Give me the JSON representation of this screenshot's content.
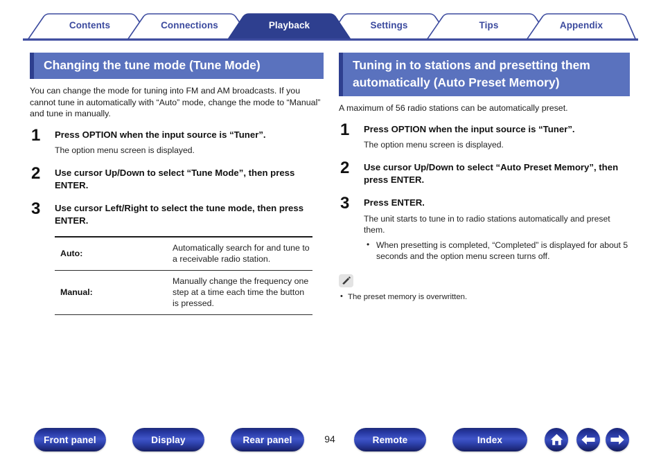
{
  "tabs": [
    {
      "label": "Contents",
      "active": false
    },
    {
      "label": "Connections",
      "active": false
    },
    {
      "label": "Playback",
      "active": true
    },
    {
      "label": "Settings",
      "active": false
    },
    {
      "label": "Tips",
      "active": false
    },
    {
      "label": "Appendix",
      "active": false
    }
  ],
  "colors": {
    "tab_outline": "#3b4a9e",
    "tab_active_bg": "#2e3f8f",
    "section_head_bg": "#5a72be",
    "section_head_accent": "#2e3f8f",
    "pill_blue": "#2637a0"
  },
  "left": {
    "heading": "Changing the tune mode (Tune Mode)",
    "intro": "You can change the mode for tuning into FM and AM broadcasts. If you cannot tune in automatically with “Auto” mode, change the mode to “Manual” and tune in manually.",
    "steps": [
      {
        "num": "1",
        "title": "Press OPTION when the input source is “Tuner”.",
        "desc": "The option menu screen is displayed."
      },
      {
        "num": "2",
        "title": "Use cursor Up/Down to select “Tune Mode”, then press ENTER.",
        "desc": ""
      },
      {
        "num": "3",
        "title": "Use cursor Left/Right to select the tune mode, then press ENTER.",
        "desc": ""
      }
    ],
    "table": {
      "rows": [
        {
          "key": "Auto:",
          "value": "Automatically search for and tune to a receivable radio station."
        },
        {
          "key": "Manual:",
          "value": "Manually change the frequency one step at a time each time the button is pressed."
        }
      ]
    }
  },
  "right": {
    "heading": "Tuning in to stations and presetting them automatically (Auto Preset Memory)",
    "intro": "A maximum of 56 radio stations can be automatically preset.",
    "steps": [
      {
        "num": "1",
        "title": "Press OPTION when the input source is “Tuner”.",
        "desc": "The option menu screen is displayed."
      },
      {
        "num": "2",
        "title": "Use cursor Up/Down to select “Auto Preset Memory”, then press ENTER.",
        "desc": ""
      },
      {
        "num": "3",
        "title": "Press ENTER.",
        "desc": "The unit starts to tune in to radio stations automatically and preset them.",
        "bullets": [
          "When presetting is completed, “Completed” is displayed for about 5 seconds and the option menu screen turns off."
        ]
      }
    ],
    "note": {
      "icon": "pencil-icon",
      "items": [
        "The preset memory is overwritten."
      ]
    }
  },
  "footer": {
    "buttons": [
      {
        "label": "Front panel"
      },
      {
        "label": "Display"
      },
      {
        "label": "Rear panel"
      },
      {
        "label": "Remote"
      },
      {
        "label": "Index"
      }
    ],
    "page_number": "94",
    "icons": [
      {
        "name": "home-icon"
      },
      {
        "name": "arrow-left-icon"
      },
      {
        "name": "arrow-right-icon"
      }
    ]
  }
}
